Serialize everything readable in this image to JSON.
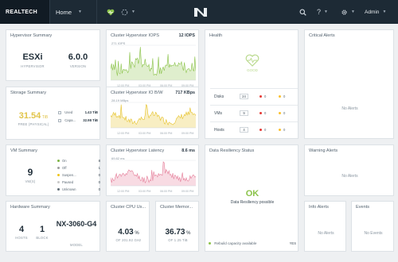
{
  "topbar": {
    "brand": "REALTECH",
    "home_label": "Home",
    "user": "Admin",
    "help_glyph": "?",
    "icons": [
      "heart-icon",
      "spinner-icon",
      "search-icon",
      "help-icon",
      "gear-icon",
      "chevron-down-icon"
    ],
    "logo": "nutanix-logo"
  },
  "hypervisor_summary": {
    "title": "Hypervisor Summary",
    "hypervisor": "ESXi",
    "hypervisor_caption": "HYPERVISOR",
    "version": "6.0.0",
    "version_caption": "VERSION"
  },
  "storage_summary": {
    "title": "Storage Summary",
    "free_value": "31.54",
    "free_unit": "TiB",
    "free_caption": "FREE (PHYSICAL)",
    "used_label": "Used",
    "used_value": "1.43 TiB",
    "capacity_label": "Capa...",
    "capacity_value": "32.98 TiB"
  },
  "vm_summary": {
    "title": "VM Summary",
    "vm_count": "9",
    "vm_caption": "VM(S)",
    "states": [
      {
        "label": "On",
        "count": "8",
        "color": "#7cb342"
      },
      {
        "label": "Off",
        "count": "1",
        "color": "#9e9e9e"
      },
      {
        "label": "Suspen...",
        "count": "0",
        "color": "#f0c419"
      },
      {
        "label": "Paused",
        "count": "0",
        "color": "#c8c8c8"
      },
      {
        "label": "Unknown",
        "count": "0",
        "color": "#5f6b75"
      }
    ]
  },
  "hardware_summary": {
    "title": "Hardware Summary",
    "hosts": "4",
    "hosts_caption": "HOSTS",
    "blocks": "1",
    "blocks_caption": "BLOCK",
    "model": "NX-3060-G4",
    "model_caption": "MODEL"
  },
  "iops_chart": {
    "title": "Cluster Hypervisor IOPS",
    "current": "12 IOPS",
    "peak_label": "271 IOPS",
    "time_labels": [
      "12:00 PM",
      "03:00 PM",
      "06:00 PM",
      "09:00 PM"
    ],
    "color": "#8bc34a"
  },
  "bw_chart": {
    "title": "Cluster Hypervisor IO B/W",
    "current": "717 KBps",
    "peak_label": "28.19 MBps",
    "time_labels": [
      "12:00 PM",
      "03:00 PM",
      "06:00 PM",
      "09:00 PM"
    ],
    "color": "#e6c229"
  },
  "latency_chart": {
    "title": "Cluster Hypervisor Latency",
    "current": "8.6 ms",
    "peak_label": "69.82 ms",
    "time_labels": [
      "12:00 PM",
      "03:00 PM",
      "06:00 PM",
      "09:00 PM"
    ],
    "color": "#e57f9a"
  },
  "cpu_usage": {
    "title": "Cluster CPU Us...",
    "value": "4.03",
    "unit": "%",
    "caption": "OF 201.92 GHz"
  },
  "memory_usage": {
    "title": "Cluster Memor...",
    "value": "36.73",
    "unit": "%",
    "caption": "OF 1.25 TiB"
  },
  "health": {
    "title": "Health",
    "status": "GOOD",
    "rows": [
      {
        "label": "Disks",
        "total": "24",
        "critical": "0",
        "warning": "0"
      },
      {
        "label": "VMs",
        "total": "9",
        "critical": "0",
        "warning": "0"
      },
      {
        "label": "Hosts",
        "total": "4",
        "critical": "0",
        "warning": "0"
      }
    ],
    "critical_color": "#e53935",
    "warning_color": "#fbc02d"
  },
  "data_resiliency": {
    "title": "Data Resiliency Status",
    "status": "OK",
    "message": "Data Resiliency possible",
    "footer": "Rebuild capacity available",
    "footer_value": "YES"
  },
  "critical_alerts": {
    "title": "Critical Alerts",
    "message": "No Alerts"
  },
  "warning_alerts": {
    "title": "Warning Alerts",
    "message": "No Alerts"
  },
  "info_alerts": {
    "title": "Info Alerts",
    "message": "No Alerts"
  },
  "events": {
    "title": "Events",
    "message": "No Events"
  }
}
